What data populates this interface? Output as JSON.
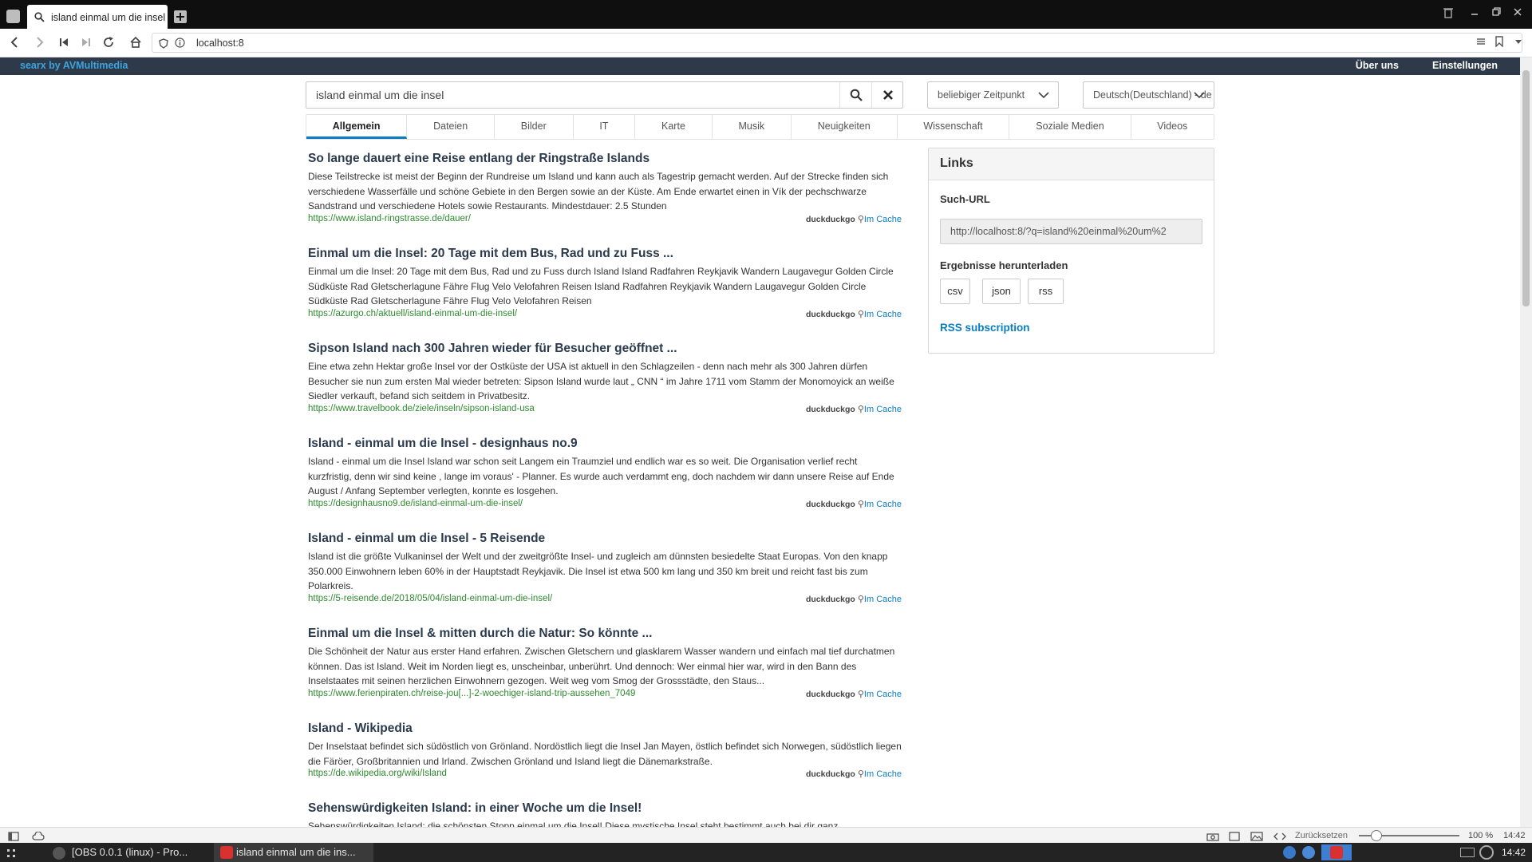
{
  "browser": {
    "tab_title": "island einmal um die insel",
    "url": "localhost:8"
  },
  "header": {
    "brand": "searx by AVMultimedia",
    "about": "Über uns",
    "preferences": "Einstellungen"
  },
  "search": {
    "query": "island einmal um die insel",
    "time_range": "beliebiger Zeitpunkt",
    "language": "Deutsch(Deutschland) - de"
  },
  "categories": [
    "Allgemein",
    "Dateien",
    "Bilder",
    "IT",
    "Karte",
    "Musik",
    "Neuigkeiten",
    "Wissenschaft",
    "Soziale Medien",
    "Videos"
  ],
  "results": [
    {
      "title": "So lange dauert eine Reise entlang der Ringstraße Islands",
      "snippet": "Diese Teilstrecke ist meist der Beginn der Rundreise um Island und kann auch als Tagestrip gemacht werden. Auf der Strecke finden sich verschiedene Wasserfälle und schöne Gebiete in den Bergen sowie an der Küste. Am Ende erwartet einen in Vík der pechschwarze Sandstrand und verschiedene Hotels sowie Restaurants. Mindestdauer: 2.5 Stunden",
      "url": "https://www.island-ringstrasse.de/dauer/",
      "engine": "duckduckgo",
      "cache": "Im Cache"
    },
    {
      "title": "Einmal um die Insel: 20 Tage mit dem Bus, Rad und zu Fuss ...",
      "snippet": "Einmal um die Insel: 20 Tage mit dem Bus, Rad und zu Fuss durch Island Island Radfahren Reykjavik Wandern Laugavegur Golden Circle Südküste Rad Gletscherlagune Fähre Flug Velo Velofahren Reisen Island Radfahren Reykjavik Wandern Laugavegur Golden Circle Südküste Rad Gletscherlagune Fähre Flug Velo Velofahren Reisen",
      "url": "https://azurgo.ch/aktuell/island-einmal-um-die-insel/",
      "engine": "duckduckgo",
      "cache": "Im Cache"
    },
    {
      "title": "Sipson Island nach 300 Jahren wieder für Besucher geöffnet ...",
      "snippet": "Eine etwa zehn Hektar große Insel vor der Ostküste der USA ist aktuell in den Schlagzeilen - denn nach mehr als 300 Jahren dürfen Besucher sie nun zum ersten Mal wieder betreten: Sipson Island wurde laut „ CNN “ im Jahre 1711 vom Stamm der Monomoyick an weiße Siedler verkauft, befand sich seitdem in Privatbesitz.",
      "url": "https://www.travelbook.de/ziele/inseln/sipson-island-usa",
      "engine": "duckduckgo",
      "cache": "Im Cache"
    },
    {
      "title": "Island - einmal um die Insel - designhaus no.9",
      "snippet": "Island - einmal um die Insel Island war schon seit Langem ein Traumziel und endlich war es so weit. Die Organisation verlief recht kurzfristig, denn wir sind keine , lange im voraus' - Planner. Es wurde auch verdammt eng, doch nachdem wir dann unsere Reise auf Ende August / Anfang September verlegten, konnte es losgehen.",
      "url": "https://designhausno9.de/island-einmal-um-die-insel/",
      "engine": "duckduckgo",
      "cache": "Im Cache"
    },
    {
      "title": "Island - einmal um die Insel - 5 Reisende",
      "snippet": "Island ist die größte Vulkaninsel der Welt und der zweitgrößte Insel- und zugleich am dünnsten besiedelte Staat Europas. Von den knapp 350.000 Einwohnern leben 60% in der Hauptstadt Reykjavik. Die Insel ist etwa 500 km lang und 350 km breit und reicht fast bis zum Polarkreis.",
      "url": "https://5-reisende.de/2018/05/04/island-einmal-um-die-insel/",
      "engine": "duckduckgo",
      "cache": "Im Cache"
    },
    {
      "title": "Einmal um die Insel & mitten durch die Natur: So könnte ...",
      "snippet": "Die Schönheit der Natur aus erster Hand erfahren. Zwischen Gletschern und glasklarem Wasser wandern und einfach mal tief durchatmen können. Das ist Island. Weit im Norden liegt es, unscheinbar, unberührt. Und dennoch: Wer einmal hier war, wird in den Bann des Inselstaates mit seinen herzlichen Einwohnern gezogen. Weit weg vom Smog der Grossstädte, den Staus...",
      "url": "https://www.ferienpiraten.ch/reise-jou[...]-2-woechiger-island-trip-aussehen_7049",
      "engine": "duckduckgo",
      "cache": "Im Cache"
    },
    {
      "title": "Island - Wikipedia",
      "snippet": "Der Inselstaat befindet sich südöstlich von Grönland. Nordöstlich liegt die Insel Jan Mayen, östlich befindet sich Norwegen, südöstlich liegen die Färöer, Großbritannien und Irland. Zwischen Grönland und Island liegt die Dänemarkstraße.",
      "url": "https://de.wikipedia.org/wiki/Island",
      "engine": "duckduckgo",
      "cache": "Im Cache"
    },
    {
      "title": "Sehenswürdigkeiten Island: in einer Woche um die Insel!",
      "snippet": "Sehenswürdigkeiten Island: die schönsten Stopp einmal um die Insel! Diese mystische Insel steht bestimmt auch bei dir ganz",
      "url": "",
      "engine": "",
      "cache": ""
    }
  ],
  "sidebar": {
    "title": "Links",
    "search_url_label": "Such-URL",
    "search_url": "http://localhost:8/?q=island%20einmal%20um%2",
    "download_label": "Ergebnisse herunterladen",
    "formats": [
      "csv",
      "json",
      "rss"
    ],
    "rss": "RSS subscription"
  },
  "statusbar": {
    "reset": "Zurücksetzen",
    "zoom": "100 %",
    "time": "14:42"
  },
  "taskbar": {
    "task1": "[OBS 0.0.1 (linux) - Pro...",
    "task2": "island einmal um die ins...",
    "clock": "14:42"
  }
}
